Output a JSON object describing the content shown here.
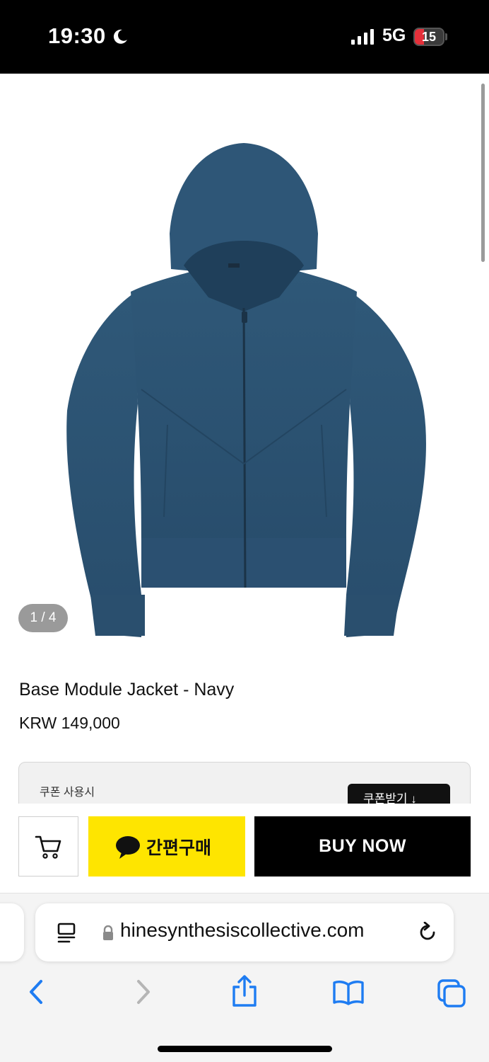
{
  "status_bar": {
    "time": "19:30",
    "network": "5G",
    "battery": "15"
  },
  "product": {
    "image_counter": "1 / 4",
    "title": "Base Module Jacket - Navy",
    "price": "KRW 149,000",
    "image_alt_icon": "hoodie-image",
    "jacket_color": "#2b5273"
  },
  "coupon": {
    "label": "쿠폰 사용시",
    "button_label": "쿠폰받기 ↓"
  },
  "buy_bar": {
    "cart_icon": "cart-icon",
    "kakao_label": "간편구매",
    "kakao_color": "#fee500",
    "buy_now_label": "BUY NOW"
  },
  "browser": {
    "url": "hinesynthesiscollective.com",
    "accent_color": "#1e7cf2",
    "icons": [
      "reader-icon",
      "lock-icon",
      "reload-icon",
      "back-icon",
      "forward-icon",
      "share-icon",
      "bookmarks-icon",
      "tabs-icon"
    ]
  }
}
